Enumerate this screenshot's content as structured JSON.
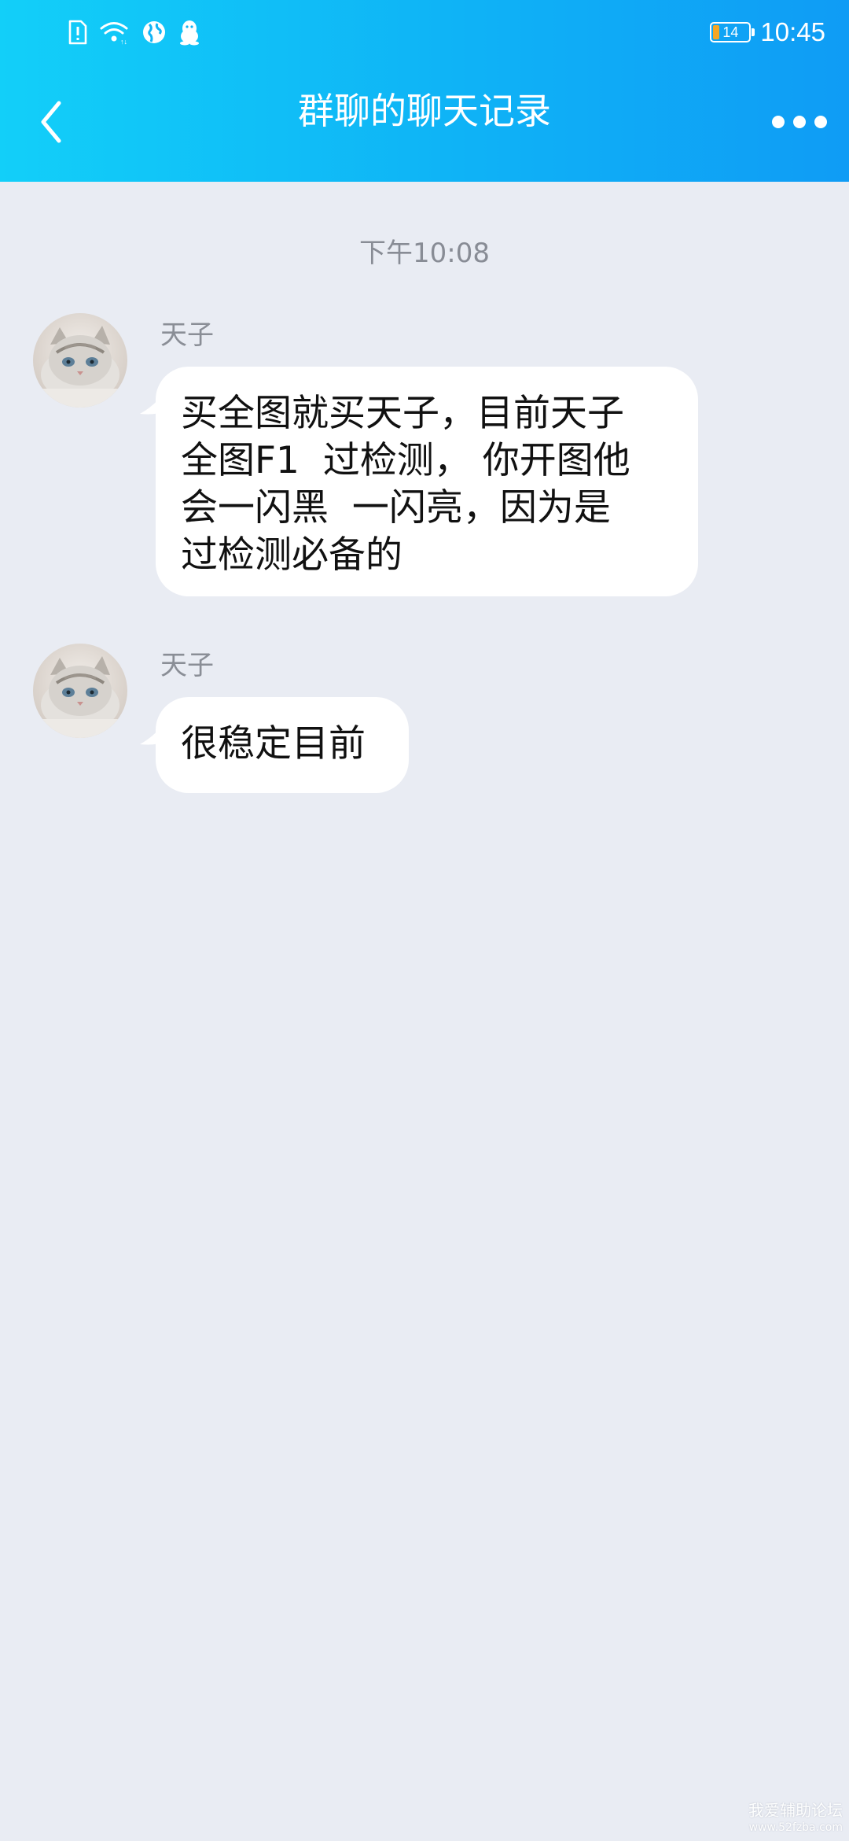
{
  "status_bar": {
    "icons": [
      "sim-alert-icon",
      "wifi-icon",
      "globe-icon",
      "qq-penguin-icon"
    ],
    "battery_level": "14",
    "time": "10:45"
  },
  "header": {
    "title": "群聊的聊天记录",
    "back_icon": "chevron-left-icon",
    "more_icon": "more-dots-icon"
  },
  "chat": {
    "timestamp": "下午10:08",
    "messages": [
      {
        "sender": "天子",
        "lines": [
          "买全图就买天子，目前天子",
          "全图F1  过检测， 你开图他",
          "会一闪黑  一闪亮，因为是",
          "过检测必备的"
        ]
      },
      {
        "sender": "天子",
        "lines": [
          "很稳定目前"
        ]
      }
    ]
  },
  "watermark": {
    "text": "我爱辅助论坛",
    "url": "www.52fzba.com"
  },
  "colors": {
    "header_start": "#12CFF9",
    "header_end": "#0F9CF5",
    "background": "#E9ECF3",
    "bubble": "#FFFFFF",
    "battery_fill": "#F6A623"
  }
}
